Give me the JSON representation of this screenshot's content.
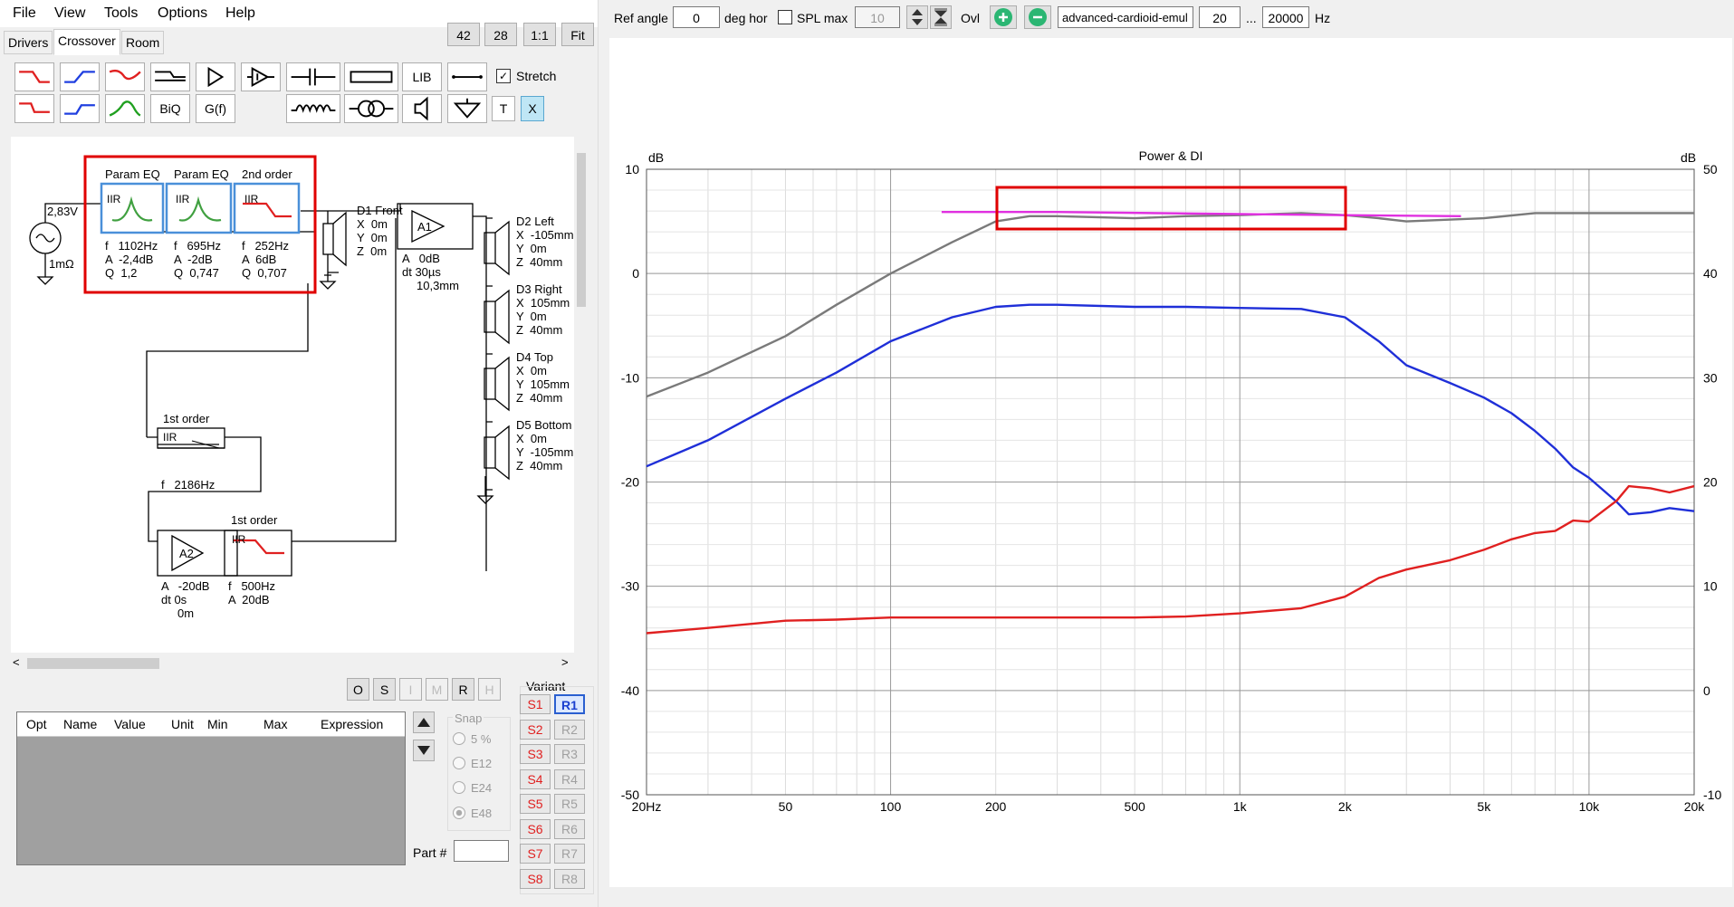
{
  "menu": {
    "file": "File",
    "view": "View",
    "tools": "Tools",
    "options": "Options",
    "help": "Help"
  },
  "tabs": {
    "drivers": "Drivers",
    "crossover": "Crossover",
    "room": "Room"
  },
  "zoom": {
    "b42": "42",
    "b28": "28",
    "b11": "1:1",
    "fit": "Fit"
  },
  "toolbar": {
    "lib": "LIB",
    "stretch": "Stretch",
    "biq": "BiQ",
    "gf": "G(f)",
    "t": "T",
    "x": "X"
  },
  "schematic": {
    "source_voltage": "2,83V",
    "source_impedance": "1mΩ",
    "eq1": {
      "title": "Param EQ",
      "type": "IIR",
      "f": "f   1102Hz",
      "a": "A  -2,4dB",
      "q": "Q  1,2"
    },
    "eq2": {
      "title": "Param EQ",
      "type": "IIR",
      "f": "f   695Hz",
      "a": "A  -2dB",
      "q": "Q  0,747"
    },
    "eq3": {
      "title": "2nd order",
      "type": "IIR",
      "f": "f   252Hz",
      "a": "A  6dB",
      "q": "Q  0,707"
    },
    "d1": {
      "name": "D1 Front",
      "x": "X  0m",
      "y": "Y  0m",
      "z": "Z  0m"
    },
    "a1": {
      "name": "A1",
      "a": "A   0dB",
      "dt": "dt 30µs",
      "dist": "10,3mm"
    },
    "d2": {
      "name": "D2 Left",
      "x": "X  -105mm",
      "y": "Y  0m",
      "z": "Z  40mm"
    },
    "d3": {
      "name": "D3 Right",
      "x": "X  105mm",
      "y": "Y  0m",
      "z": "Z  40mm"
    },
    "d4": {
      "name": "D4 Top",
      "x": "X  0m",
      "y": "Y  105mm",
      "z": "Z  40mm"
    },
    "d5": {
      "name": "D5 Bottom",
      "x": "X  0m",
      "y": "Y  -105mm",
      "z": "Z  40mm"
    },
    "f1": {
      "title": "1st order",
      "type": "IIR",
      "f": "f   2186Hz"
    },
    "a2": {
      "name": "A2",
      "a": "A   -20dB",
      "dt": "dt 0s",
      "dist": "0m"
    },
    "f2": {
      "title": "1st order",
      "type": "IIR",
      "f": "f   500Hz",
      "a": "A  20dB"
    }
  },
  "optbuttons": {
    "o": "O",
    "s": "S",
    "i": "I",
    "m": "M",
    "r": "R",
    "h": "H"
  },
  "params": {
    "cols": [
      "Opt",
      "Name",
      "Value",
      "Unit",
      "Min",
      "Max",
      "Expression"
    ]
  },
  "snap": {
    "title": "Snap",
    "o1": "5 %",
    "o2": "E12",
    "o3": "E24",
    "o4": "E48"
  },
  "part": {
    "label": "Part #",
    "value": ""
  },
  "variant": {
    "title": "Variant",
    "s": [
      "S1",
      "S2",
      "S3",
      "S4",
      "S5",
      "S6",
      "S7",
      "S8"
    ],
    "r": [
      "R1",
      "R2",
      "R3",
      "R4",
      "R5",
      "R6",
      "R7",
      "R8"
    ]
  },
  "topbar": {
    "ref_angle_label": "Ref angle",
    "ref_angle": "0",
    "deg_label": "deg hor",
    "spl_max_label": "SPL max",
    "spl_max": "10",
    "ovl": "Ovl",
    "filename": "advanced-cardioid-emul",
    "f_min": "20",
    "dots": "...",
    "f_max": "20000",
    "hz": "Hz"
  },
  "chart_data": {
    "type": "line",
    "title": "Power & DI",
    "ylabel_left": "dB",
    "ylabel_right": "dB",
    "xscale": "log",
    "xlim": [
      20,
      20000
    ],
    "ylim_left": [
      -50,
      10
    ],
    "ylim_right": [
      -10,
      50
    ],
    "x_ticks": [
      {
        "v": 20,
        "l": "20Hz"
      },
      {
        "v": 50,
        "l": "50"
      },
      {
        "v": 100,
        "l": "100"
      },
      {
        "v": 200,
        "l": "200"
      },
      {
        "v": 500,
        "l": "500"
      },
      {
        "v": 1000,
        "l": "1k"
      },
      {
        "v": 2000,
        "l": "2k"
      },
      {
        "v": 5000,
        "l": "5k"
      },
      {
        "v": 10000,
        "l": "10k"
      },
      {
        "v": 20000,
        "l": "20k"
      }
    ],
    "y_ticks_left": [
      10,
      0,
      -10,
      -20,
      -30,
      -40,
      -50
    ],
    "y_ticks_right": [
      50,
      40,
      30,
      20,
      10,
      0,
      -10
    ],
    "grid": true,
    "series": [
      {
        "color": "#7a7a7a",
        "axis": "left",
        "x": [
          20,
          30,
          50,
          70,
          100,
          150,
          200,
          250,
          300,
          500,
          700,
          1000,
          1500,
          2000,
          2500,
          3000,
          5000,
          7000,
          10000,
          15000,
          20000
        ],
        "y": [
          -11.8,
          -9.5,
          -6,
          -3,
          0,
          3,
          5,
          5.5,
          5.5,
          5.3,
          5.5,
          5.6,
          5.8,
          5.6,
          5.3,
          5,
          5.3,
          5.8,
          5.8,
          5.8,
          5.8
        ]
      },
      {
        "color": "#1f2fd8",
        "axis": "left",
        "x": [
          20,
          30,
          50,
          70,
          100,
          150,
          200,
          250,
          300,
          500,
          700,
          1000,
          1500,
          2000,
          2500,
          3000,
          4000,
          5000,
          6000,
          7000,
          8000,
          9000,
          10000,
          12000,
          13000,
          15000,
          17000,
          20000
        ],
        "y": [
          -18.5,
          -16,
          -12,
          -9.5,
          -6.5,
          -4.2,
          -3.2,
          -3,
          -3,
          -3.2,
          -3.2,
          -3.3,
          -3.4,
          -4.2,
          -6.5,
          -8.8,
          -10.5,
          -11.9,
          -13.4,
          -15.1,
          -16.8,
          -18.6,
          -19.6,
          -21.9,
          -23.1,
          -22.9,
          -22.5,
          -22.8
        ]
      },
      {
        "color": "#e02020",
        "axis": "left",
        "x": [
          20,
          30,
          50,
          70,
          100,
          150,
          200,
          300,
          500,
          700,
          1000,
          1500,
          2000,
          2500,
          3000,
          4000,
          5000,
          6000,
          7000,
          8000,
          9000,
          10000,
          12000,
          13000,
          15000,
          17000,
          20000
        ],
        "y": [
          -34.5,
          -34,
          -33.3,
          -33.2,
          -33,
          -33,
          -33,
          -33,
          -33,
          -32.9,
          -32.6,
          -32.1,
          -31,
          -29.2,
          -28.4,
          -27.5,
          -26.5,
          -25.5,
          -24.9,
          -24.7,
          -23.7,
          -23.8,
          -21.8,
          -20.4,
          -20.6,
          -21,
          -20.4
        ]
      },
      {
        "color": "#e030e0",
        "axis": "left",
        "x": [
          140,
          300,
          1000,
          2000,
          4300
        ],
        "y": [
          5.9,
          5.9,
          5.7,
          5.6,
          5.5
        ]
      }
    ]
  },
  "colors": {
    "highlight": "#e00000",
    "accent_blue": "#4a90d9"
  }
}
